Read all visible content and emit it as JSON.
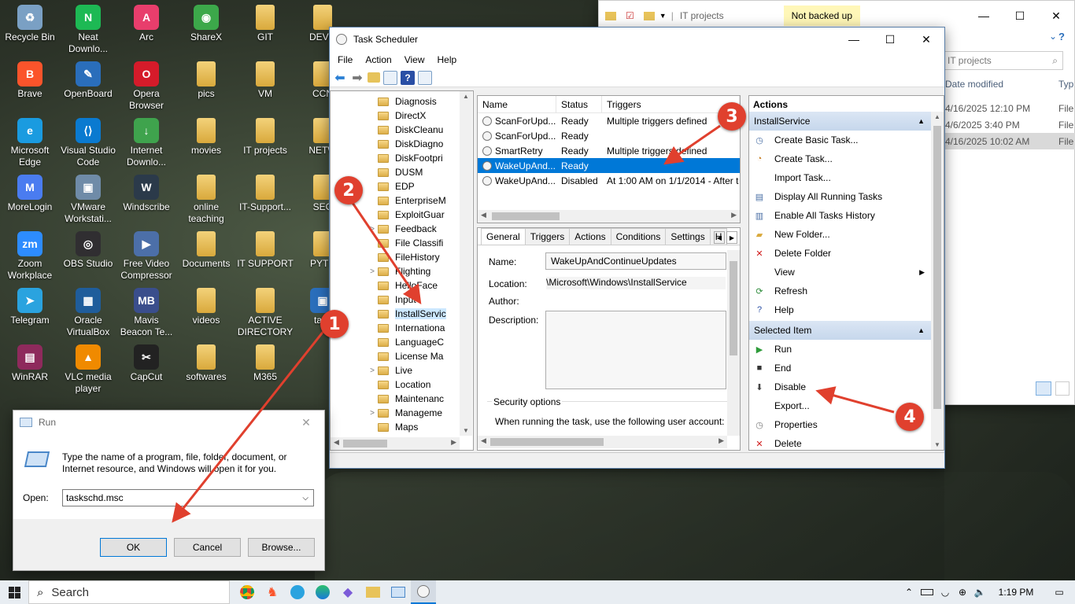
{
  "desktop_icons": [
    {
      "label": "Recycle Bin",
      "glyph": "♻",
      "color": "#7aa0c4"
    },
    {
      "label": "Neat Downlo...",
      "glyph": "N",
      "color": "#1db954"
    },
    {
      "label": "Arc",
      "glyph": "A",
      "color": "#e83e6c"
    },
    {
      "label": "ShareX",
      "glyph": "◉",
      "color": "#3ca84a"
    },
    {
      "label": "GIT",
      "glyph": "",
      "color": ""
    },
    {
      "label": "DEVO",
      "glyph": "",
      "color": ""
    },
    {
      "label": "Brave",
      "glyph": "B",
      "color": "#fb542b"
    },
    {
      "label": "OpenBoard",
      "glyph": "✎",
      "color": "#2a6ebb"
    },
    {
      "label": "Opera Browser",
      "glyph": "O",
      "color": "#d51b2a"
    },
    {
      "label": "pics",
      "glyph": "",
      "color": ""
    },
    {
      "label": "VM",
      "glyph": "",
      "color": ""
    },
    {
      "label": "CCN",
      "glyph": "",
      "color": ""
    },
    {
      "label": "Microsoft Edge",
      "glyph": "e",
      "color": "#1a9be0"
    },
    {
      "label": "Visual Studio Code",
      "glyph": "⟨⟩",
      "color": "#0a7ad0"
    },
    {
      "label": "Internet Downlo...",
      "glyph": "↓",
      "color": "#3fa34d"
    },
    {
      "label": "movies",
      "glyph": "",
      "color": ""
    },
    {
      "label": "IT projects",
      "glyph": "",
      "color": ""
    },
    {
      "label": "NETW",
      "glyph": "",
      "color": ""
    },
    {
      "label": "MoreLogin",
      "glyph": "M",
      "color": "#4a7cf0"
    },
    {
      "label": "VMware Workstati...",
      "glyph": "▣",
      "color": "#6f8ba8"
    },
    {
      "label": "Windscribe",
      "glyph": "W",
      "color": "#2b3a4a"
    },
    {
      "label": "online teaching",
      "glyph": "",
      "color": ""
    },
    {
      "label": "IT-Support...",
      "glyph": "",
      "color": ""
    },
    {
      "label": "SEC",
      "glyph": "",
      "color": ""
    },
    {
      "label": "Zoom Workplace",
      "glyph": "zm",
      "color": "#2d8cff"
    },
    {
      "label": "OBS Studio",
      "glyph": "◎",
      "color": "#302e31"
    },
    {
      "label": "Free Video Compressor",
      "glyph": "▶",
      "color": "#4c6fa8"
    },
    {
      "label": "Documents",
      "glyph": "",
      "color": ""
    },
    {
      "label": "IT SUPPORT",
      "glyph": "",
      "color": ""
    },
    {
      "label": "PYTH",
      "glyph": "",
      "color": ""
    },
    {
      "label": "Telegram",
      "glyph": "➤",
      "color": "#2aa3df"
    },
    {
      "label": "Oracle VirtualBox",
      "glyph": "▦",
      "color": "#1f5d9b"
    },
    {
      "label": "Mavis Beacon Te...",
      "glyph": "MB",
      "color": "#3a4e8c"
    },
    {
      "label": "videos",
      "glyph": "",
      "color": ""
    },
    {
      "label": "ACTIVE DIRECTORY",
      "glyph": "",
      "color": ""
    },
    {
      "label": "task",
      "glyph": "▣",
      "color": "#2a6ebb"
    },
    {
      "label": "WinRAR",
      "glyph": "▤",
      "color": "#8e2a5c"
    },
    {
      "label": "VLC media player",
      "glyph": "▲",
      "color": "#f08a00"
    },
    {
      "label": "CapCut",
      "glyph": "✂",
      "color": "#222"
    },
    {
      "label": "softwares",
      "glyph": "",
      "color": ""
    },
    {
      "label": "M365",
      "glyph": "",
      "color": ""
    }
  ],
  "explorer": {
    "title": "IT projects",
    "badge": "Not backed up",
    "search_placeholder": "IT projects",
    "col_date": "Date modified",
    "col_type": "Typ",
    "rows": [
      {
        "date": "4/16/2025 12:10 PM",
        "type": "File"
      },
      {
        "date": "4/6/2025 3:40 PM",
        "type": "File"
      },
      {
        "date": "4/16/2025 10:02 AM",
        "type": "File"
      }
    ]
  },
  "task_scheduler": {
    "title": "Task Scheduler",
    "menu": [
      "File",
      "Action",
      "View",
      "Help"
    ],
    "tree": [
      {
        "label": "Diagnosis",
        "exp": ""
      },
      {
        "label": "DirectX",
        "exp": ""
      },
      {
        "label": "DiskCleanu",
        "exp": ""
      },
      {
        "label": "DiskDiagno",
        "exp": ""
      },
      {
        "label": "DiskFootpri",
        "exp": ""
      },
      {
        "label": "DUSM",
        "exp": ""
      },
      {
        "label": "EDP",
        "exp": ""
      },
      {
        "label": "EnterpriseM",
        "exp": ""
      },
      {
        "label": "ExploitGuar",
        "exp": ""
      },
      {
        "label": "Feedback",
        "exp": ">"
      },
      {
        "label": "File Classifi",
        "exp": ""
      },
      {
        "label": "FileHistory",
        "exp": ""
      },
      {
        "label": "Flighting",
        "exp": ">"
      },
      {
        "label": "HelloFace",
        "exp": ""
      },
      {
        "label": "Input",
        "exp": ""
      },
      {
        "label": "InstallServic",
        "exp": ""
      },
      {
        "label": "Internationa",
        "exp": ""
      },
      {
        "label": "LanguageC",
        "exp": ""
      },
      {
        "label": "License Ma",
        "exp": ""
      },
      {
        "label": "Live",
        "exp": ">"
      },
      {
        "label": "Location",
        "exp": ""
      },
      {
        "label": "Maintenanc",
        "exp": ""
      },
      {
        "label": "Manageme",
        "exp": ">"
      },
      {
        "label": "Maps",
        "exp": ""
      }
    ],
    "task_columns": [
      "Name",
      "Status",
      "Triggers"
    ],
    "tasks": [
      {
        "name": "ScanForUpd...",
        "status": "Ready",
        "triggers": "Multiple triggers defined"
      },
      {
        "name": "ScanForUpd...",
        "status": "Ready",
        "triggers": ""
      },
      {
        "name": "SmartRetry",
        "status": "Ready",
        "triggers": "Multiple triggers defined"
      },
      {
        "name": "WakeUpAnd...",
        "status": "Ready",
        "triggers": ""
      },
      {
        "name": "WakeUpAnd...",
        "status": "Disabled",
        "triggers": "At 1:00 AM on 1/1/2014 - After t"
      }
    ],
    "tabs": [
      "General",
      "Triggers",
      "Actions",
      "Conditions",
      "Settings",
      "H"
    ],
    "general": {
      "name_label": "Name:",
      "name_value": "WakeUpAndContinueUpdates",
      "location_label": "Location:",
      "location_value": "\\Microsoft\\Windows\\InstallService",
      "author_label": "Author:",
      "description_label": "Description:",
      "security_title": "Security options",
      "security_text": "When running the task, use the following user account:"
    },
    "actions_title": "Actions",
    "section1_title": "InstallService",
    "section1_items": [
      {
        "label": "Create Basic Task...",
        "icon": "◷",
        "color": "#4a6fa5"
      },
      {
        "label": "Create Task...",
        "icon": "◔",
        "color": "#c57a1c"
      },
      {
        "label": "Import Task...",
        "icon": "",
        "color": ""
      },
      {
        "label": "Display All Running Tasks",
        "icon": "▤",
        "color": "#4a6fa5"
      },
      {
        "label": "Enable All Tasks History",
        "icon": "▥",
        "color": "#4a6fa5"
      },
      {
        "label": "New Folder...",
        "icon": "▰",
        "color": "#d9a93c"
      },
      {
        "label": "Delete Folder",
        "icon": "✕",
        "color": "#d01818"
      },
      {
        "label": "View",
        "icon": "",
        "color": "",
        "submenu": "▶"
      },
      {
        "label": "Refresh",
        "icon": "⟳",
        "color": "#2e8b3a"
      },
      {
        "label": "Help",
        "icon": "?",
        "color": "#2a4fa5"
      }
    ],
    "section2_title": "Selected Item",
    "section2_items": [
      {
        "label": "Run",
        "icon": "▶",
        "color": "#2e9b3a"
      },
      {
        "label": "End",
        "icon": "■",
        "color": "#333"
      },
      {
        "label": "Disable",
        "icon": "⬇",
        "color": "#444"
      },
      {
        "label": "Export...",
        "icon": "",
        "color": ""
      },
      {
        "label": "Properties",
        "icon": "◷",
        "color": "#777"
      },
      {
        "label": "Delete",
        "icon": "✕",
        "color": "#d01818"
      }
    ]
  },
  "run_dialog": {
    "title": "Run",
    "description": "Type the name of a program, file, folder, document, or Internet resource, and Windows will open it for you.",
    "open_label": "Open:",
    "open_value": "taskschd.msc",
    "ok": "OK",
    "cancel": "Cancel",
    "browse": "Browse..."
  },
  "annotations": [
    "1",
    "2",
    "3",
    "4"
  ],
  "taskbar": {
    "search_label": "Search",
    "time": "1:19 PM"
  }
}
